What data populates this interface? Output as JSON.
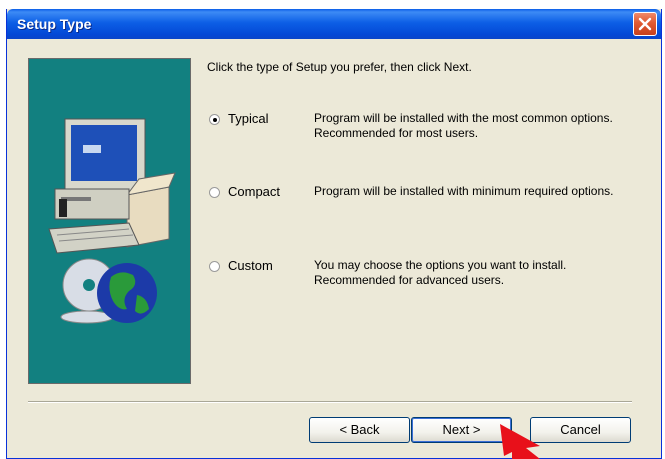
{
  "window": {
    "title": "Setup Type"
  },
  "prompt": "Click the type of Setup you prefer, then click Next.",
  "options": [
    {
      "label": "Typical",
      "description": "Program will be installed with the most common options.  Recommended for most users.",
      "checked": true
    },
    {
      "label": "Compact",
      "description": "Program will be installed with minimum required options.",
      "checked": false
    },
    {
      "label": "Custom",
      "description": "You may choose the options you want to install. Recommended for advanced users.",
      "checked": false
    }
  ],
  "buttons": {
    "back": "< Back",
    "next": "Next >",
    "cancel": "Cancel"
  },
  "colors": {
    "titlebar": "#0348d6",
    "panel_bg": "#ece9d8",
    "image_bg": "#128080",
    "arrow": "#e8101a"
  },
  "icons": {
    "close": "close-icon",
    "side_image": "computer-cd-globe-illustration",
    "pointer": "red-arrow-pointer"
  }
}
